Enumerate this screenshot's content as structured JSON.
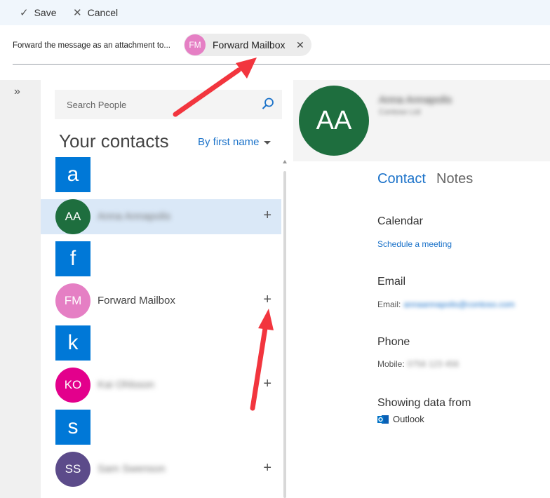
{
  "toolbar": {
    "save_label": "Save",
    "cancel_label": "Cancel"
  },
  "forward": {
    "label": "Forward the message as an attachment to...",
    "recipient": {
      "initials": "FM",
      "name": "Forward Mailbox",
      "color": "#e57fc4"
    }
  },
  "people": {
    "search_placeholder": "Search People",
    "heading": "Your contacts",
    "sort_label": "By first name",
    "groups": [
      {
        "letter": "a",
        "contact": {
          "initials": "AA",
          "name": "Anna Annapolis",
          "color": "#1e6e3e",
          "selected": true
        }
      },
      {
        "letter": "f",
        "contact": {
          "initials": "FM",
          "name": "Forward Mailbox",
          "color": "#e57fc4",
          "selected": false
        }
      },
      {
        "letter": "k",
        "contact": {
          "initials": "KO",
          "name": "Kai Ohlsson",
          "color": "#e3008c",
          "selected": false
        }
      },
      {
        "letter": "s",
        "contact": {
          "initials": "SS",
          "name": "Sam Swenson",
          "color": "#5c4b8a",
          "selected": false
        }
      }
    ]
  },
  "detail": {
    "initials": "AA",
    "name": "Anna Annapolis",
    "subtitle": "Contoso Ltd",
    "tabs": {
      "contact": "Contact",
      "notes": "Notes"
    },
    "calendar": {
      "title": "Calendar",
      "link": "Schedule a meeting"
    },
    "email": {
      "title": "Email",
      "label": "Email:",
      "value": "annaannapolis@contoso.com"
    },
    "phone": {
      "title": "Phone",
      "label": "Mobile:",
      "value": "0756 123 456"
    },
    "source": {
      "title": "Showing data from",
      "app": "Outlook"
    }
  },
  "colors": {
    "accent": "#1b72c9",
    "tile": "#0078d7",
    "annotation_arrow": "#f2353e"
  }
}
